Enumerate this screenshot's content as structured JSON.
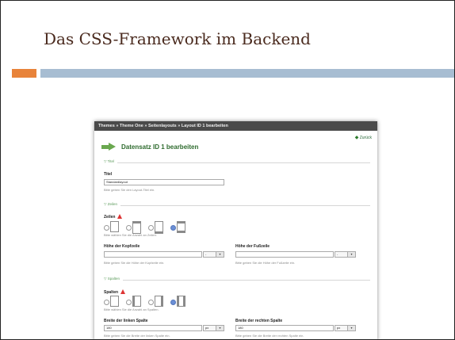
{
  "slide": {
    "title": "Das CSS-Framework im Backend"
  },
  "screenshot": {
    "breadcrumb": "Themes » Theme One » Seitenlayouts » Layout ID 1 bearbeiten",
    "back_label": "Zurück",
    "heading": "Datensatz ID 1 bearbeiten",
    "section_title": {
      "legend": "Titel",
      "label": "Titel",
      "value": "Standardlayout",
      "hint": "Bitte geben Sie den Layout-Titel ein."
    },
    "section_rows": {
      "legend": "Zeilen",
      "label": "Zeilen",
      "hint": "Bitte wählen Sie die Anzahl an Zeilen.",
      "header_label": "Höhe der Kopfzeile",
      "header_unit": "-",
      "header_hint": "Bitte geben Sie die Höhe der Kopfzeile ein.",
      "footer_label": "Höhe der Fußzeile",
      "footer_unit": "-",
      "footer_hint": "Bitte geben Sie die Höhe der Fußzeile ein."
    },
    "section_cols": {
      "legend": "Spalten",
      "label": "Spalten",
      "hint": "Bitte wählen Sie die Anzahl an Spalten.",
      "left_label": "Breite der linken Spalte",
      "left_value": "180",
      "left_unit": "px",
      "left_hint": "Bitte geben Sie die Breite der linken Spalte ein.",
      "right_label": "Breite der rechten Spalte",
      "right_value": "180",
      "right_unit": "px",
      "right_hint": "Bitte geben Sie die Breite der rechten Spalte ein."
    },
    "colors": {
      "accent_green": "#2e6b2e",
      "breadcrumb_bg": "#4a4a4a",
      "warn": "#dd3333"
    }
  },
  "decor": {
    "bar_orange": "#e8833a",
    "bar_blue": "#a7bdd2"
  }
}
